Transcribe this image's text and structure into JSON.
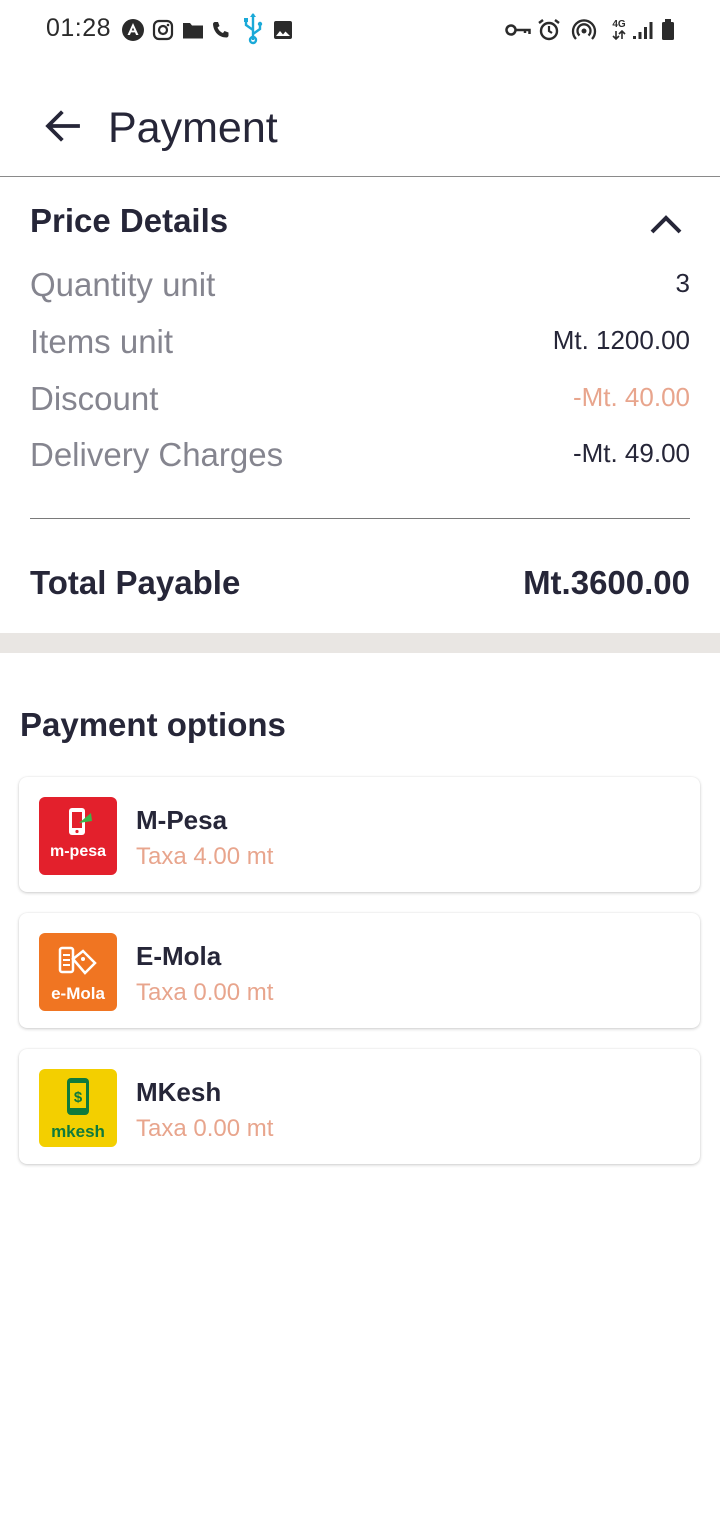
{
  "status_bar": {
    "time": "01:28",
    "left_icons": [
      "angular-icon",
      "instagram-icon",
      "folder-icon",
      "phone-icon",
      "usb-icon",
      "image-icon"
    ],
    "right_icons": [
      "vpn-key-icon",
      "alarm-icon",
      "hotspot-icon",
      "network-4g-icon",
      "signal-icon",
      "battery-icon"
    ],
    "network_label": "4G"
  },
  "app_bar": {
    "title": "Payment",
    "back_icon": "arrow-left-icon"
  },
  "price_details": {
    "title": "Price Details",
    "collapse_icon": "chevron-up-icon",
    "rows": [
      {
        "label": "Quantity unit",
        "value": "3"
      },
      {
        "label": "Items unit",
        "value": "Mt. 1200.00"
      },
      {
        "label": "Discount",
        "value": "-Mt. 40.00"
      },
      {
        "label": "Delivery Charges",
        "value": "-Mt. 49.00"
      }
    ],
    "total_label": "Total Payable",
    "total_value": "Mt.3600.00"
  },
  "payment_options": {
    "title": "Payment options",
    "items": [
      {
        "name": "M-Pesa",
        "fee": "Taxa 4.00 mt",
        "logo_text": "m-pesa",
        "logo_color": "#e3202c"
      },
      {
        "name": "E-Mola",
        "fee": "Taxa 0.00 mt",
        "logo_text": "e-Mola",
        "logo_color": "#f07522"
      },
      {
        "name": "MKesh",
        "fee": "Taxa 0.00 mt",
        "logo_text": "mkesh",
        "logo_color": "#f3cf00"
      }
    ]
  },
  "colors": {
    "primary_text": "#262638",
    "secondary_text": "#85858f",
    "accent_fee": "#e8a58d",
    "section_gap": "#e9e6e3"
  }
}
